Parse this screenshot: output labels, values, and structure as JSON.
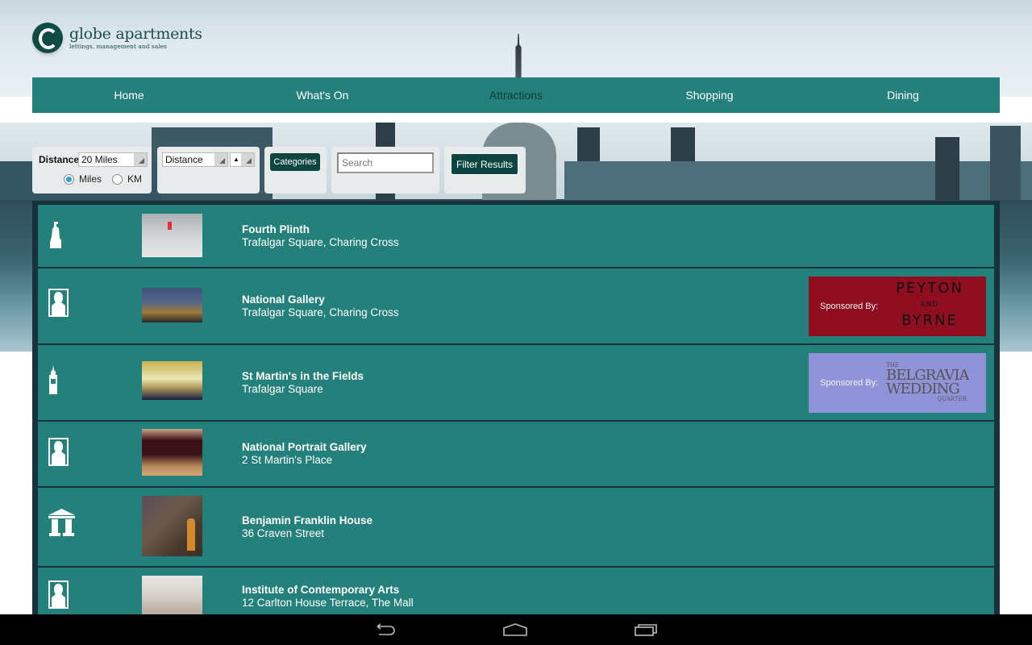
{
  "brand": {
    "name": "globe apartments",
    "tagline": "lettings, management and sales"
  },
  "nav": {
    "items": [
      {
        "label": "Home",
        "active": false
      },
      {
        "label": "What's On",
        "active": false
      },
      {
        "label": "Attractions",
        "active": true
      },
      {
        "label": "Shopping",
        "active": false
      },
      {
        "label": "Dining",
        "active": false
      }
    ]
  },
  "filters": {
    "distance_label": "Distance",
    "distance_value": "20 Miles",
    "units": [
      {
        "label": "Miles",
        "selected": true
      },
      {
        "label": "KM",
        "selected": false
      }
    ],
    "sort_value": "Distance",
    "sort_direction": "▲",
    "categories_label": "Categories",
    "search_placeholder": "Search",
    "search_value": "",
    "filter_button_label": "Filter Results"
  },
  "attractions": [
    {
      "name": "Fourth Plinth",
      "address": "Trafalgar Square, Charing Cross",
      "icon": "statue-icon",
      "thumb_colors": [
        "#9ea3a4",
        "#c9cdcf",
        "#e4e6e7"
      ]
    },
    {
      "name": "National Gallery",
      "address": "Trafalgar Square, Charing Cross",
      "icon": "portrait-icon",
      "thumb_colors": [
        "#3b4e73",
        "#7a6a45",
        "#c8a04a"
      ],
      "sponsor": {
        "label": "Sponsored By:",
        "name_lines": [
          "PEYTON",
          "AND",
          "BYRNE"
        ],
        "bg": "#8f0f20",
        "fg": "#111111"
      }
    },
    {
      "name": "St Martin's in the Fields",
      "address": "Trafalgar Square",
      "icon": "tower-icon",
      "thumb_colors": [
        "#c9b34e",
        "#eeeabd",
        "#1c2440"
      ],
      "sponsor": {
        "label": "Sponsored By:",
        "name_lines": [
          "THE",
          "BELGRAVIA",
          "WEDDING",
          "QUARTER"
        ],
        "bg": "#9193d8",
        "fg": "#555555"
      }
    },
    {
      "name": "National Portrait Gallery",
      "address": "2 St Martin's Place",
      "icon": "portrait-icon",
      "thumb_colors": [
        "#2a0b0f",
        "#7a3a2a",
        "#c79566"
      ]
    },
    {
      "name": "Benjamin Franklin House",
      "address": "36 Craven Street",
      "icon": "museum-icon",
      "thumb_colors": [
        "#4a3a30",
        "#6b5648",
        "#c98a3a"
      ]
    },
    {
      "name": "Institute of Contemporary Arts",
      "address": "12 Carlton House Terrace, The Mall",
      "icon": "portrait-icon",
      "thumb_colors": [
        "#d9d5d0",
        "#b9a99a",
        "#f2f0ee"
      ]
    }
  ],
  "system_nav": {
    "back": "back-icon",
    "home": "home-icon",
    "recents": "recents-icon"
  }
}
